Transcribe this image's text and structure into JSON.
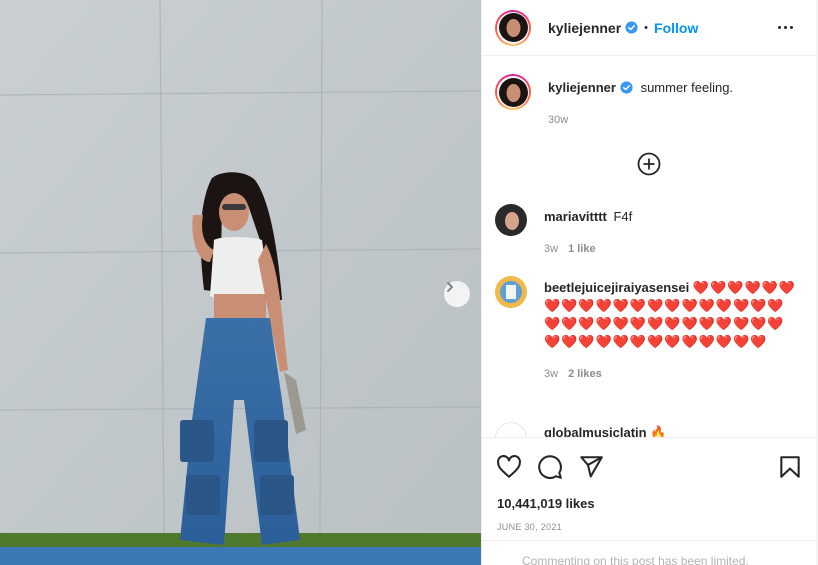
{
  "post": {
    "author": "kyliejenner",
    "follow_label": "Follow",
    "dot": "•",
    "caption": "summer feeling.",
    "caption_time": "30w",
    "likes": "10,441,019 likes",
    "date": "JUNE 30, 2021",
    "comment_hint": "Commenting on this post has been limited."
  },
  "comments": [
    {
      "user": "mariavitttt",
      "text": "F4f",
      "time": "3w",
      "likes": "1 like"
    },
    {
      "user": "beetlejuicejiraiyasensei",
      "text": "❤️❤️❤️❤️❤️❤️❤️❤️❤️❤️❤️❤️❤️❤️❤️❤️❤️❤️❤️❤️❤️❤️❤️❤️❤️❤️❤️❤️❤️❤️❤️❤️❤️❤️❤️❤️❤️❤️❤️❤️❤️❤️❤️❤️❤️❤️❤️",
      "time": "3w",
      "likes": "2 likes"
    },
    {
      "user": "globalmusiclatin",
      "text": "🔥"
    }
  ],
  "icons": {
    "verified": "verified-badge-icon",
    "more": "more-options-icon",
    "load_more": "load-more-comments-icon",
    "next": "carousel-next-icon",
    "like": "heart-icon",
    "comment": "comment-icon",
    "share": "share-icon",
    "save": "bookmark-icon"
  },
  "colors": {
    "accent": "#0095f6",
    "text": "#262626",
    "muted": "#8e8e8e",
    "heart": "#e0245e"
  }
}
